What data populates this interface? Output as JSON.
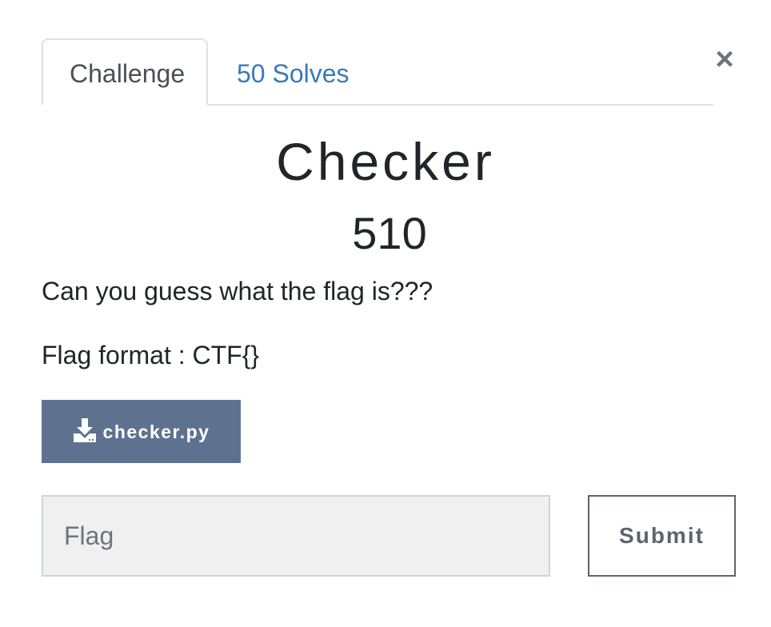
{
  "tabs": [
    {
      "label": "Challenge",
      "active": true
    },
    {
      "label": "50 Solves",
      "active": false
    }
  ],
  "close_label": "×",
  "challenge": {
    "name": "Checker",
    "points": "510",
    "description": [
      "Can you guess what the flag is???",
      "Flag format : CTF{}"
    ],
    "file": {
      "name": "checker.py",
      "icon": "download-icon"
    }
  },
  "flag_input": {
    "value": "",
    "placeholder": "Flag"
  },
  "submit_label": "Submit",
  "colors": {
    "download_button": "#5e7290",
    "tab_link": "#3a7ab8",
    "submit_border": "#5b6570"
  }
}
